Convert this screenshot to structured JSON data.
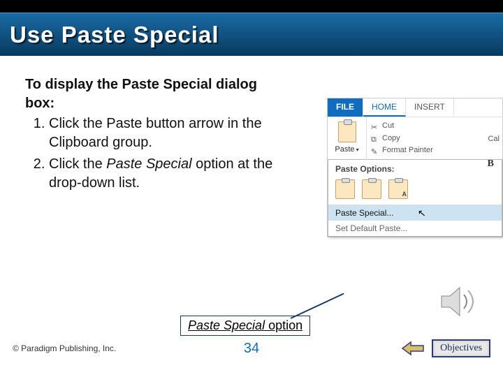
{
  "slide": {
    "title": "Use Paste Special",
    "intro": "To display the Paste Special dialog box:",
    "steps": [
      {
        "pre": "Click the Paste button arrow in the Clipboard group.",
        "italic_at": null
      },
      {
        "pre": "Click the ",
        "ital": "Paste Special",
        "post": " option at the drop-down list."
      }
    ],
    "callout_ital": "Paste Special",
    "callout_norm": " option",
    "page_number": "34",
    "copyright": "© Paradigm Publishing, Inc.",
    "objectives_label": "Objectives"
  },
  "ribbon": {
    "tabs": {
      "file": "FILE",
      "home": "HOME",
      "insert": "INSERT"
    },
    "paste_label": "Paste",
    "cut": "Cut",
    "copy": "Copy",
    "fpainter": "Format Painter",
    "font_hint": "Cal",
    "bold": "B",
    "dd_head": "Paste Options:",
    "dd_special": "Paste Special...",
    "dd_default": "Set Default Paste...",
    "opt_subs": [
      "",
      "",
      "A"
    ]
  }
}
